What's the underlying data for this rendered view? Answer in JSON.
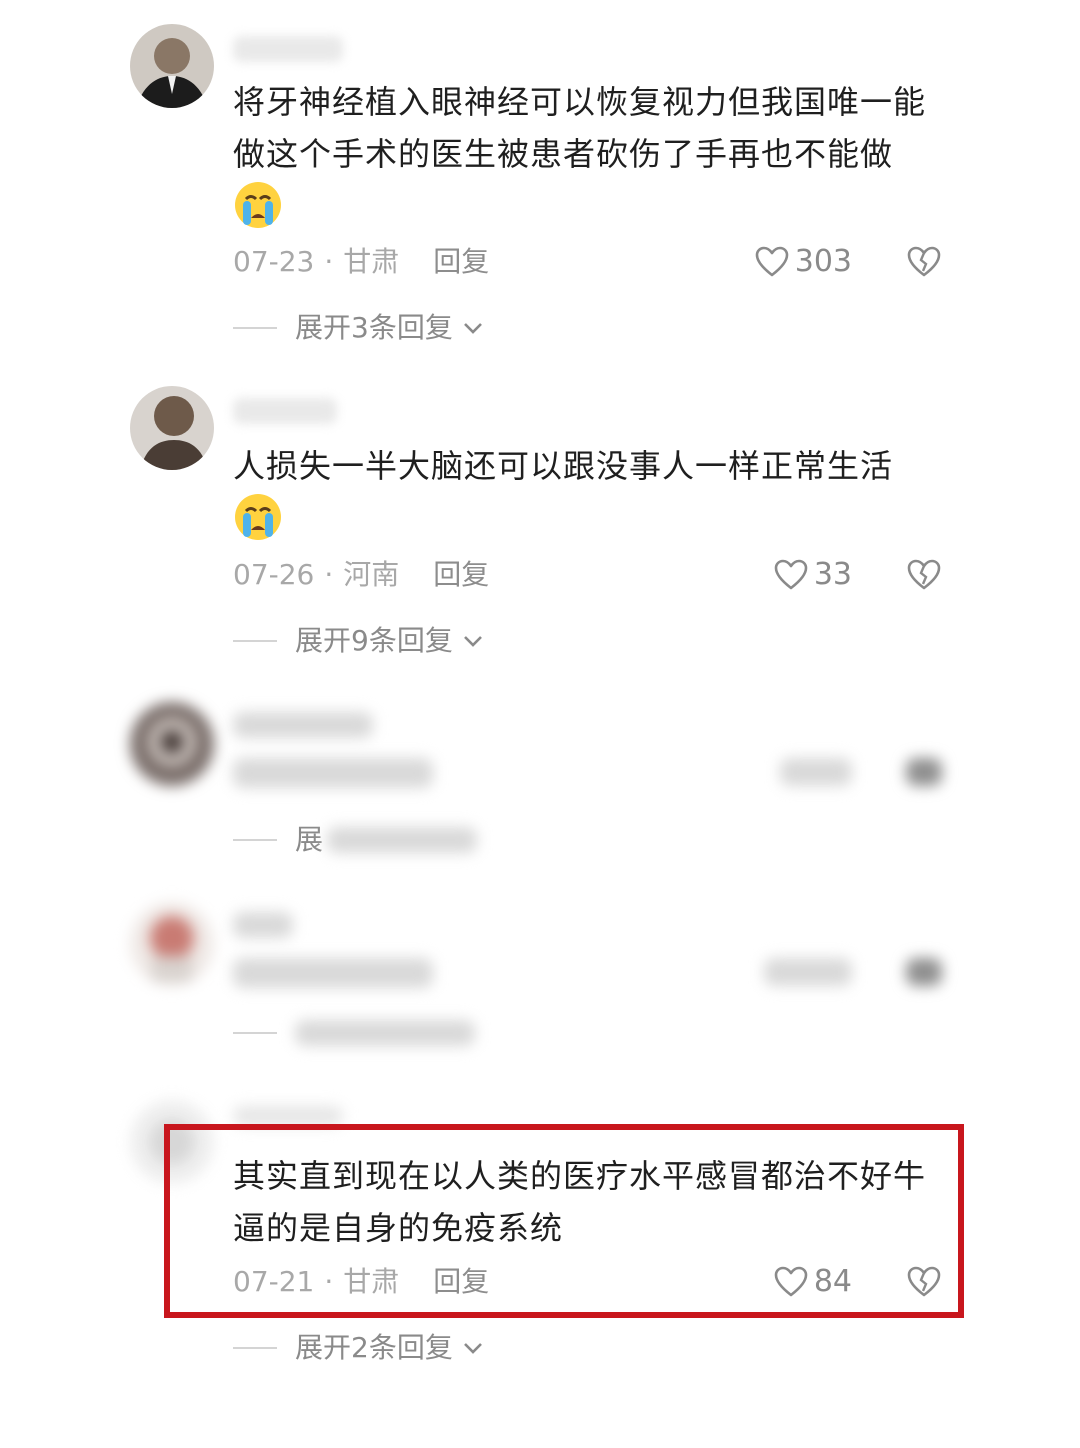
{
  "comments": [
    {
      "text": "将牙神经植入眼神经可以恢复视力但我国唯一能做这个手术的医生被患者砍伤了手再也不能做",
      "emoji": "crying-face",
      "date": "07-23",
      "location": "甘肃",
      "reply_label": "回复",
      "likes": "303",
      "expand_label": "展开3条回复"
    },
    {
      "text": "人损失一半大脑还可以跟没事人一样正常生活",
      "emoji": "crying-face",
      "date": "07-26",
      "location": "河南",
      "reply_label": "回复",
      "likes": "33",
      "expand_label": "展开9条回复"
    },
    {
      "expand_label": "展"
    },
    {
      "text": "其实直到现在以人类的医疗水平感冒都治不好牛逼的是自身的免疫系统",
      "date": "07-21",
      "location": "甘肃",
      "reply_label": "回复",
      "likes": "84",
      "expand_label": "展开2条回复"
    }
  ],
  "separator": "·",
  "colors": {
    "highlight_border": "#c8161d",
    "text": "#1f1f1f",
    "meta": "#a8a8a8"
  }
}
